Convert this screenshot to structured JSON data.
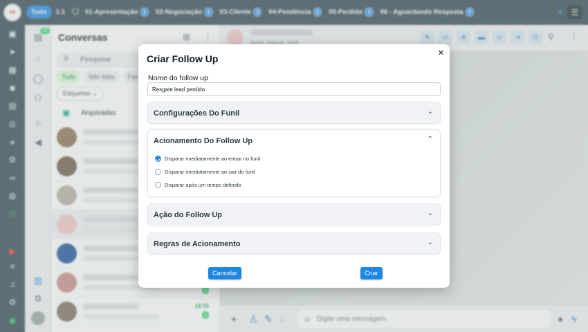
{
  "topbar": {
    "tabs": [
      {
        "label": "Tudo",
        "count": ""
      },
      {
        "label": "1:1",
        "count": ""
      },
      {
        "label": "01-Apresentação",
        "count": "3"
      },
      {
        "label": "02-Negociação",
        "count": "3"
      },
      {
        "label": "03-Cliente",
        "count": "3"
      },
      {
        "label": "04-Pendência",
        "count": "2"
      },
      {
        "label": "05-Perdido",
        "count": "3"
      },
      {
        "label": "06 - Aguardando Resposta",
        "count": "0"
      }
    ]
  },
  "secondary": {
    "badge": "35"
  },
  "conversations": {
    "title": "Conversas",
    "search_placeholder": "Pesquisar",
    "filters": [
      "Tudo",
      "Não lidas",
      "Favo"
    ],
    "tags_label": "Etiquetas",
    "archived_label": "Arquivadas",
    "rows": [
      {
        "time": "",
        "count": ""
      },
      {
        "time": "",
        "count": ""
      },
      {
        "time": "",
        "count": ""
      },
      {
        "time": "",
        "count": ""
      },
      {
        "time": "",
        "count": ""
      },
      {
        "time": "",
        "count": "2"
      },
      {
        "time": "18:55",
        "count": "3"
      }
    ]
  },
  "chat": {
    "participants": "Andre, Gabriel, Você",
    "message_placeholder": "Digite uma mensagem"
  },
  "modal": {
    "title": "Criar Follow Up",
    "name_label": "Nome do follow up",
    "name_value": "Resgate lead perdido",
    "sections": {
      "funil": "Configurações Do Funil",
      "acionamento": "Acionamento Do Follow Up",
      "acao": "Ação do Follow Up",
      "regras": "Regras de Acionamento"
    },
    "options": [
      "Disparar imediatamente ao entrar no funil",
      "Disparar imediatamente ao sair do funil",
      "Disparar após um tempo definido"
    ],
    "cancel_label": "Cancelar",
    "create_label": "Criar"
  },
  "colors": {
    "accent": "#1f87e0",
    "rail": "#2f4650",
    "green": "#25d366"
  }
}
